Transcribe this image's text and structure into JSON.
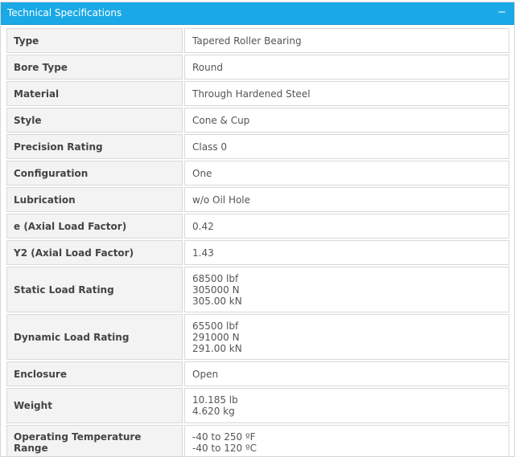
{
  "panel": {
    "title": "Technical Specifications",
    "collapse_glyph": "−",
    "collapse_icon": "minus-icon"
  },
  "specs": [
    {
      "label": "Type",
      "values": [
        "Tapered Roller Bearing"
      ]
    },
    {
      "label": "Bore Type",
      "values": [
        "Round"
      ]
    },
    {
      "label": "Material",
      "values": [
        "Through Hardened Steel"
      ]
    },
    {
      "label": "Style",
      "values": [
        "Cone & Cup"
      ]
    },
    {
      "label": "Precision Rating",
      "values": [
        "Class 0"
      ]
    },
    {
      "label": "Configuration",
      "values": [
        "One"
      ]
    },
    {
      "label": "Lubrication",
      "values": [
        "w/o Oil Hole"
      ]
    },
    {
      "label": "e (Axial Load Factor)",
      "values": [
        "0.42"
      ]
    },
    {
      "label": "Y2 (Axial Load Factor)",
      "values": [
        "1.43"
      ]
    },
    {
      "label": "Static Load Rating",
      "values": [
        "68500 lbf",
        "305000 N",
        "305.00 kN"
      ]
    },
    {
      "label": "Dynamic Load Rating",
      "values": [
        "65500 lbf",
        "291000 N",
        "291.00 kN"
      ]
    },
    {
      "label": "Enclosure",
      "values": [
        "Open"
      ]
    },
    {
      "label": "Weight",
      "values": [
        "10.185 lb",
        "4.620 kg"
      ]
    },
    {
      "label": "Operating Temperature Range",
      "values": [
        "-40 to 250 ºF",
        "-40 to 120 ºC"
      ]
    }
  ],
  "colors": {
    "header_bg": "#1aa9e6",
    "label_bg": "#f3f3f3",
    "border": "#d8d8d8"
  }
}
